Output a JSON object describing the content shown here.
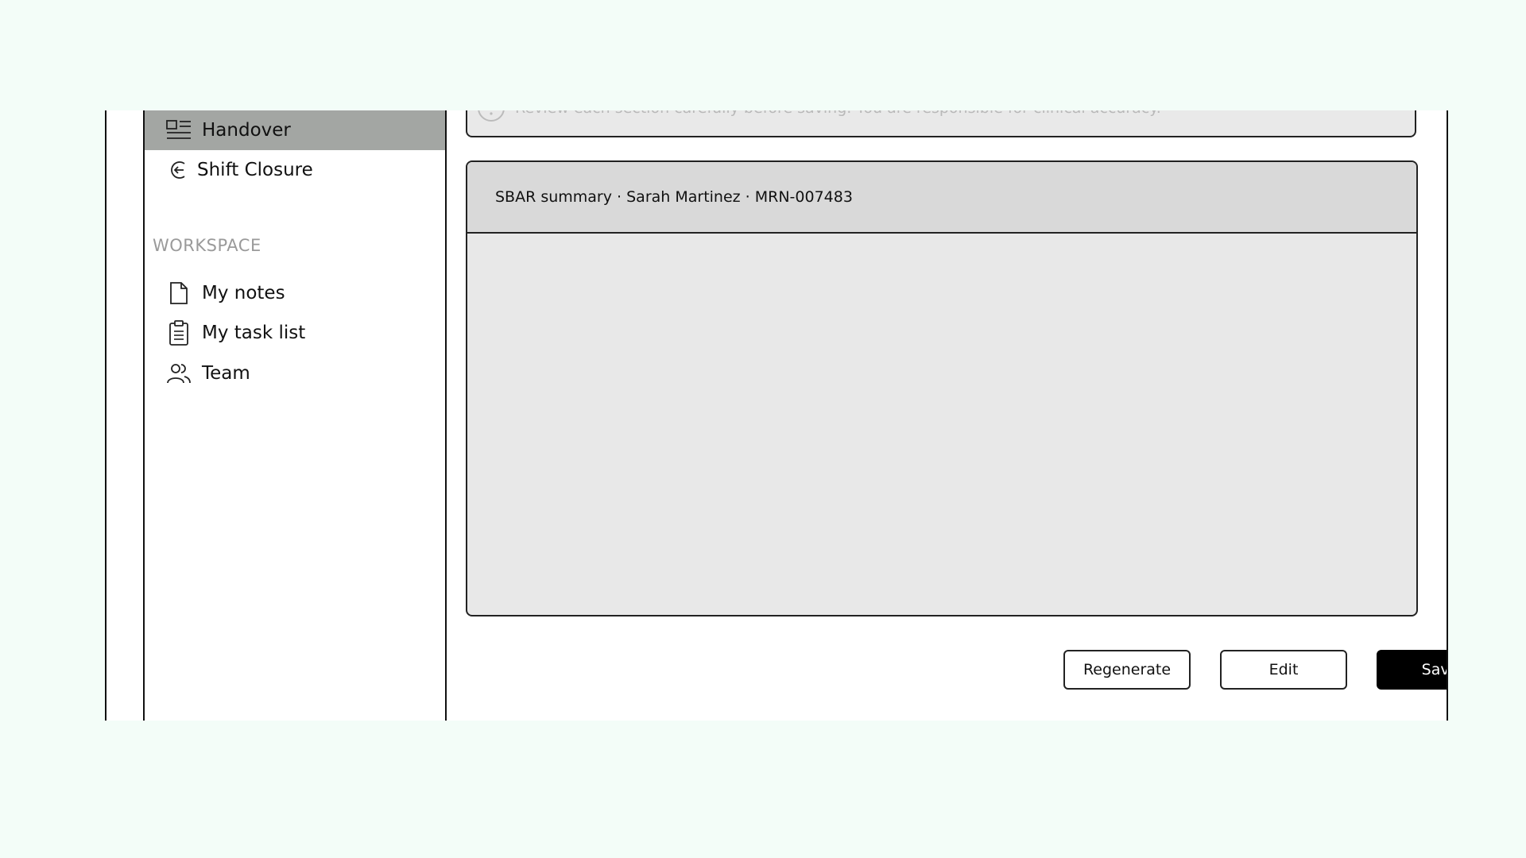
{
  "sidebar": {
    "items": [
      {
        "label": "Handover",
        "icon": "list-layout-icon",
        "active": true
      },
      {
        "label": "Shift Closure",
        "icon": "exit-arrow-icon",
        "active": false
      }
    ],
    "workspace_label": "WORKSPACE",
    "workspace_items": [
      {
        "label": "My notes",
        "icon": "document-icon"
      },
      {
        "label": "My task list",
        "icon": "clipboard-icon"
      },
      {
        "label": "Team",
        "icon": "users-icon"
      }
    ]
  },
  "main": {
    "notice": {
      "text": "Review each section carefully before saving. You are responsible for clinical accuracy.",
      "icon": "info-icon"
    },
    "summary": {
      "header": "SBAR summary · Sarah Martinez · MRN-007483"
    },
    "actions": {
      "regenerate_label": "Regenerate",
      "edit_label": "Edit",
      "save_label": "Save"
    }
  },
  "colors": {
    "background": "#f3fdf8",
    "active_nav": "#a3a6a3",
    "primary_button": "#000000"
  }
}
